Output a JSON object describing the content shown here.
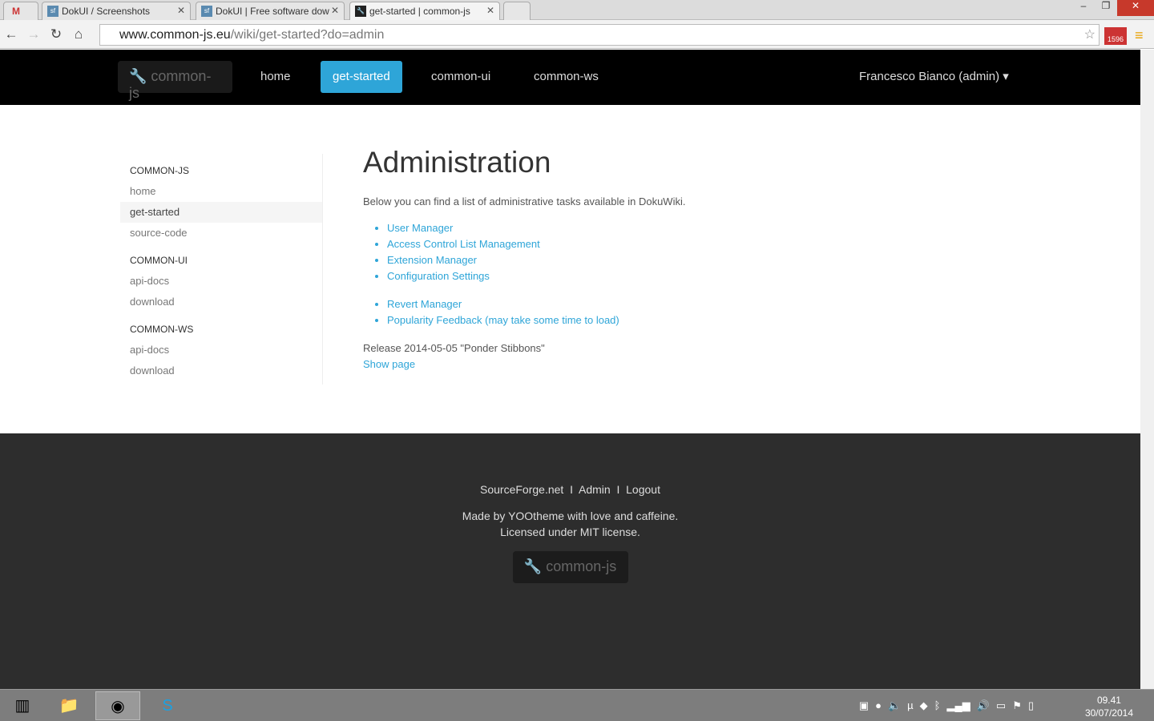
{
  "browser": {
    "tabs": [
      {
        "label": "DokUI / Screenshots"
      },
      {
        "label": "DokUI | Free software dow"
      },
      {
        "label": "get-started | common-js"
      }
    ],
    "url_host": "www.common-js.eu",
    "url_path": "/wiki/get-started?do=admin",
    "ext_badge": "1596"
  },
  "nav": {
    "brand": "common-js",
    "links": [
      "home",
      "get-started",
      "common-ui",
      "common-ws"
    ],
    "user": "Francesco Bianco (admin)"
  },
  "sidebar": [
    {
      "heading": "COMMON-JS",
      "items": [
        "home",
        "get-started",
        "source-code"
      ]
    },
    {
      "heading": "COMMON-UI",
      "items": [
        "api-docs",
        "download"
      ]
    },
    {
      "heading": "COMMON-WS",
      "items": [
        "api-docs",
        "download"
      ]
    }
  ],
  "main": {
    "title": "Administration",
    "intro": "Below you can find a list of administrative tasks available in DokuWiki.",
    "tasks": [
      "User Manager",
      "Access Control List Management",
      "Extension Manager",
      "Configuration Settings"
    ],
    "extra": [
      "Revert Manager",
      "Popularity Feedback (may take some time to load)"
    ],
    "release": "Release 2014-05-05 \"Ponder Stibbons\"",
    "show_page": "Show page"
  },
  "footer": {
    "links": [
      "SourceForge.net",
      "Admin",
      "Logout"
    ],
    "sep": "I",
    "line1": "Made by YOOtheme with love and caffeine.",
    "line2": "Licensed under MIT license.",
    "brand": "common-js"
  },
  "taskbar": {
    "time": "09.41",
    "date": "30/07/2014"
  }
}
